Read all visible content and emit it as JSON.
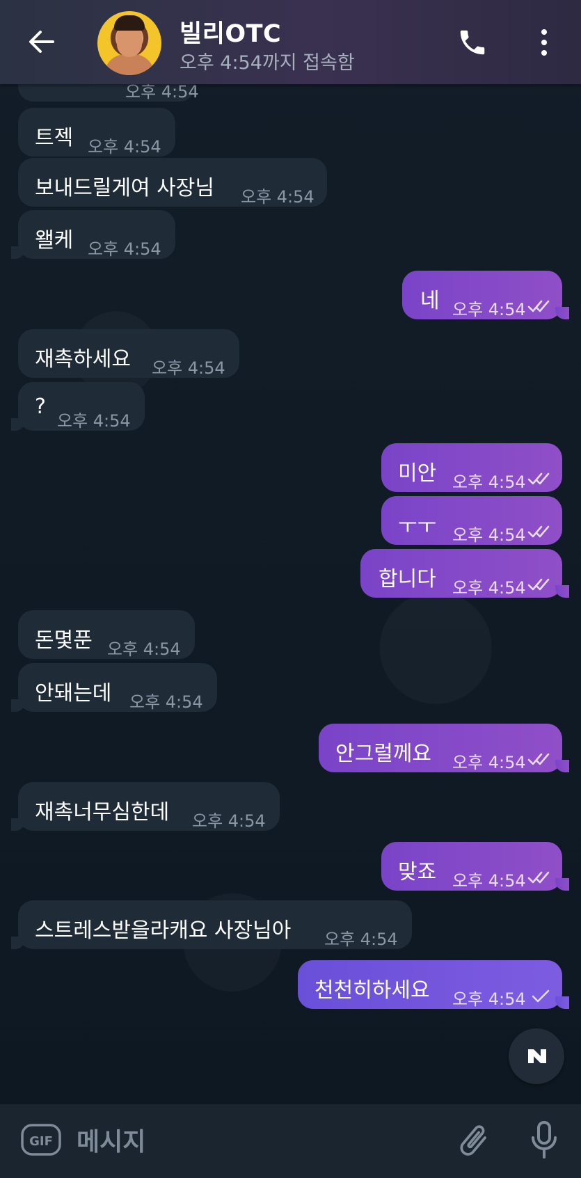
{
  "header": {
    "title": "빌리OTC",
    "status": "오후 4:54까지 접속함"
  },
  "messages": [
    {
      "text": "",
      "time": "오후 4:54"
    },
    {
      "text": "트젝",
      "time": "오후 4:54"
    },
    {
      "text": "보내드릴게여 사장님",
      "time": "오후 4:54"
    },
    {
      "text": "왤케",
      "time": "오후 4:54"
    },
    {
      "text": "네",
      "time": "오후 4:54"
    },
    {
      "text": "재촉하세요",
      "time": "오후 4:54"
    },
    {
      "text": "?",
      "time": "오후 4:54"
    },
    {
      "text": "미안",
      "time": "오후 4:54"
    },
    {
      "text": "ㅜㅜ",
      "time": "오후 4:54"
    },
    {
      "text": "합니다",
      "time": "오후 4:54"
    },
    {
      "text": "돈몇푼",
      "time": "오후 4:54"
    },
    {
      "text": "안돼는데",
      "time": "오후 4:54"
    },
    {
      "text": "안그럴께요",
      "time": "오후 4:54"
    },
    {
      "text": "재촉너무심한데",
      "time": "오후 4:54"
    },
    {
      "text": "맞죠",
      "time": "오후 4:54"
    },
    {
      "text": "스트레스받을라캐요 사장님아",
      "time": "오후 4:54"
    },
    {
      "text": "천천히하세요",
      "time": "오후 4:54"
    }
  ],
  "input": {
    "placeholder": "메시지",
    "gif_label": "GIF"
  },
  "icons": {
    "back": "back-arrow-icon",
    "call": "phone-icon",
    "more": "more-vertical-icon",
    "read": "double-check-icon",
    "sent": "single-check-icon",
    "scroll": "scroll-down-icon",
    "attach": "paperclip-icon",
    "mic": "microphone-icon"
  },
  "colors": {
    "outgoing_bubble": "#8a4ccb",
    "incoming_bubble": "#1f2b37",
    "header_bg": "#332f48"
  }
}
